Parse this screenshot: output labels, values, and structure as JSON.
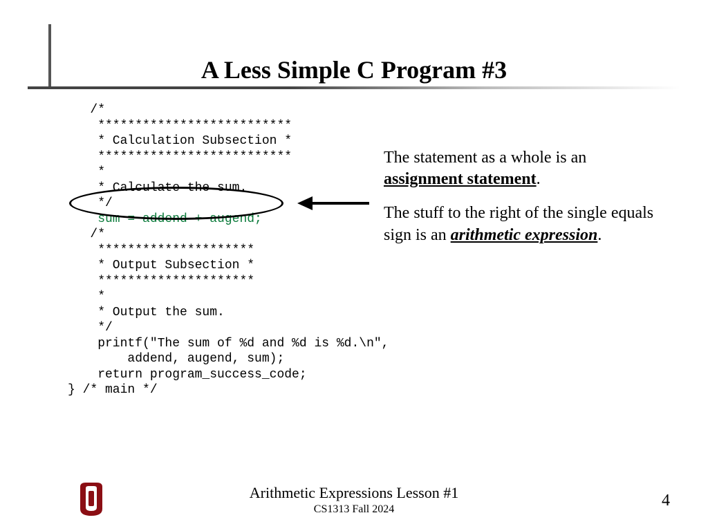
{
  "title": "A Less Simple C Program #3",
  "code": {
    "l01": "   /*",
    "l02": "    **************************",
    "l03": "    * Calculation Subsection *",
    "l04": "    **************************",
    "l05": "    *",
    "l06": "    * Calculate the sum.",
    "l07": "    */",
    "l08": "    sum = addend + augend;",
    "l09": "   /*",
    "l10": "    *********************",
    "l11": "    * Output Subsection *",
    "l12": "    *********************",
    "l13": "    *",
    "l14": "    * Output the sum.",
    "l15": "    */",
    "l16": "    printf(\"The sum of %d and %d is %d.\\n\",",
    "l17": "        addend, augend, sum);",
    "l18": "    return program_success_code;",
    "l19": "} /* main */"
  },
  "explanation": {
    "p1a": "The statement as a whole is an ",
    "p1b": "assignment statement",
    "p1c": ".",
    "p2a": "The stuff to the right of the single equals sign is an ",
    "p2b": "arithmetic expression",
    "p2c": "."
  },
  "footer": {
    "title": "Arithmetic Expressions Lesson #1",
    "subtitle": "CS1313 Fall 2024",
    "page": "4"
  },
  "logo": {
    "color": "#8b0e14"
  }
}
